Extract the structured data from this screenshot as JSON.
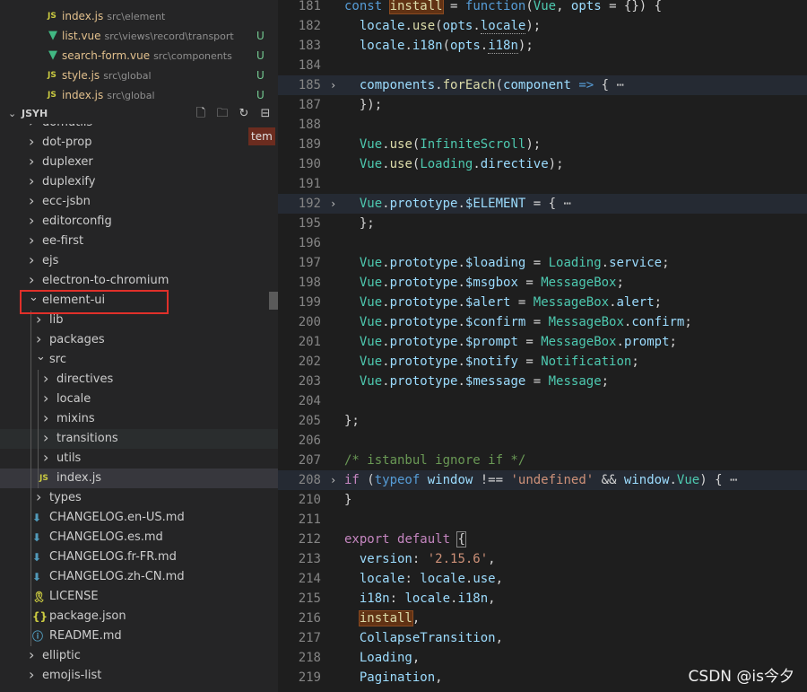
{
  "open_editors": [
    {
      "name": "index.js",
      "path": "src\\element",
      "type": "js",
      "badge": ""
    },
    {
      "name": "list.vue",
      "path": "src\\views\\record\\transport",
      "type": "vue",
      "badge": "U"
    },
    {
      "name": "search-form.vue",
      "path": "src\\components",
      "type": "vue",
      "badge": "U"
    },
    {
      "name": "style.js",
      "path": "src\\global",
      "type": "js",
      "badge": "U"
    },
    {
      "name": "index.js",
      "path": "src\\global",
      "type": "js",
      "badge": "U"
    }
  ],
  "explorer": {
    "title": "JSYH",
    "tooltip": "tem",
    "tree": [
      {
        "label": "domutils",
        "depth": 0,
        "kind": "folder",
        "open": false
      },
      {
        "label": "dot-prop",
        "depth": 0,
        "kind": "folder",
        "open": false
      },
      {
        "label": "duplexer",
        "depth": 0,
        "kind": "folder",
        "open": false
      },
      {
        "label": "duplexify",
        "depth": 0,
        "kind": "folder",
        "open": false
      },
      {
        "label": "ecc-jsbn",
        "depth": 0,
        "kind": "folder",
        "open": false
      },
      {
        "label": "editorconfig",
        "depth": 0,
        "kind": "folder",
        "open": false
      },
      {
        "label": "ee-first",
        "depth": 0,
        "kind": "folder",
        "open": false
      },
      {
        "label": "ejs",
        "depth": 0,
        "kind": "folder",
        "open": false
      },
      {
        "label": "electron-to-chromium",
        "depth": 0,
        "kind": "folder",
        "open": false
      },
      {
        "label": "element-ui",
        "depth": 0,
        "kind": "folder",
        "open": true
      },
      {
        "label": "lib",
        "depth": 1,
        "kind": "folder",
        "open": false
      },
      {
        "label": "packages",
        "depth": 1,
        "kind": "folder",
        "open": false
      },
      {
        "label": "src",
        "depth": 1,
        "kind": "folder",
        "open": true
      },
      {
        "label": "directives",
        "depth": 2,
        "kind": "folder",
        "open": false
      },
      {
        "label": "locale",
        "depth": 2,
        "kind": "folder",
        "open": false
      },
      {
        "label": "mixins",
        "depth": 2,
        "kind": "folder",
        "open": false
      },
      {
        "label": "transitions",
        "depth": 2,
        "kind": "folder",
        "open": false,
        "state": "hover"
      },
      {
        "label": "utils",
        "depth": 2,
        "kind": "folder",
        "open": false
      },
      {
        "label": "index.js",
        "depth": 2,
        "kind": "js",
        "state": "selected"
      },
      {
        "label": "types",
        "depth": 1,
        "kind": "folder",
        "open": false
      },
      {
        "label": "CHANGELOG.en-US.md",
        "depth": 1,
        "kind": "md"
      },
      {
        "label": "CHANGELOG.es.md",
        "depth": 1,
        "kind": "md"
      },
      {
        "label": "CHANGELOG.fr-FR.md",
        "depth": 1,
        "kind": "md"
      },
      {
        "label": "CHANGELOG.zh-CN.md",
        "depth": 1,
        "kind": "md"
      },
      {
        "label": "LICENSE",
        "depth": 1,
        "kind": "license"
      },
      {
        "label": "package.json",
        "depth": 1,
        "kind": "json"
      },
      {
        "label": "README.md",
        "depth": 1,
        "kind": "info"
      },
      {
        "label": "elliptic",
        "depth": 0,
        "kind": "folder",
        "open": false
      },
      {
        "label": "emojis-list",
        "depth": 0,
        "kind": "folder",
        "open": false
      }
    ]
  },
  "icons": {
    "new_file": "new-file-icon",
    "new_folder": "new-folder-icon",
    "refresh": "refresh-icon",
    "collapse": "collapse-all-icon",
    "folder_closed": "chevron-right-icon",
    "folder_open": "chevron-down-icon",
    "js": "js-file-icon",
    "vue": "vue-file-icon",
    "md": "markdown-file-icon",
    "license": "license-file-icon",
    "json": "json-file-icon",
    "info": "info-file-icon"
  },
  "colors": {
    "highlight_box": "#e0302a",
    "untracked": "#73c991",
    "vue_icon": "#41b883",
    "js_icon": "#cbcb41",
    "md_icon": "#519aba"
  },
  "code_lines": [
    {
      "n": "181",
      "fold": false,
      "hl": false,
      "tokens": [
        [
          "kw",
          "const "
        ],
        [
          "mark",
          "install"
        ],
        [
          "pn",
          " = "
        ],
        [
          "kw",
          "function"
        ],
        [
          "pn",
          "("
        ],
        [
          "cls",
          "Vue"
        ],
        [
          "pn",
          ", "
        ],
        [
          "var",
          "opts"
        ],
        [
          "pn",
          " = {}) {"
        ]
      ]
    },
    {
      "n": "182",
      "fold": false,
      "hl": false,
      "tokens": [
        [
          "pn",
          "  "
        ],
        [
          "var",
          "locale"
        ],
        [
          "pn",
          "."
        ],
        [
          "fn",
          "use"
        ],
        [
          "pn",
          "("
        ],
        [
          "var",
          "opts"
        ],
        [
          "pn",
          "."
        ],
        [
          "var-ul",
          "locale"
        ],
        [
          "pn",
          ");"
        ]
      ]
    },
    {
      "n": "183",
      "fold": false,
      "hl": false,
      "tokens": [
        [
          "pn",
          "  "
        ],
        [
          "var",
          "locale"
        ],
        [
          "pn",
          "."
        ],
        [
          "var",
          "i18n"
        ],
        [
          "pn",
          "("
        ],
        [
          "var",
          "opts"
        ],
        [
          "pn",
          "."
        ],
        [
          "var-ul",
          "i18n"
        ],
        [
          "pn",
          ");"
        ]
      ]
    },
    {
      "n": "184",
      "blank": true
    },
    {
      "n": "185",
      "fold": true,
      "hl": true,
      "tokens": [
        [
          "pn",
          "  "
        ],
        [
          "var",
          "components"
        ],
        [
          "pn",
          "."
        ],
        [
          "fn",
          "forEach"
        ],
        [
          "pn",
          "("
        ],
        [
          "var",
          "component"
        ],
        [
          "pn",
          " "
        ],
        [
          "kw",
          "=>"
        ],
        [
          "pn",
          " { "
        ],
        [
          "dim",
          "⋯"
        ]
      ]
    },
    {
      "n": "187",
      "fold": false,
      "hl": false,
      "tokens": [
        [
          "pn",
          "  });"
        ]
      ]
    },
    {
      "n": "188",
      "fold": false,
      "hl": false,
      "tokens": []
    },
    {
      "n": "189",
      "fold": false,
      "hl": false,
      "tokens": [
        [
          "pn",
          "  "
        ],
        [
          "cls",
          "Vue"
        ],
        [
          "pn",
          "."
        ],
        [
          "fn",
          "use"
        ],
        [
          "pn",
          "("
        ],
        [
          "cls",
          "InfiniteScroll"
        ],
        [
          "pn",
          ");"
        ]
      ]
    },
    {
      "n": "190",
      "fold": false,
      "hl": false,
      "tokens": [
        [
          "pn",
          "  "
        ],
        [
          "cls",
          "Vue"
        ],
        [
          "pn",
          "."
        ],
        [
          "fn",
          "use"
        ],
        [
          "pn",
          "("
        ],
        [
          "cls",
          "Loading"
        ],
        [
          "pn",
          "."
        ],
        [
          "var",
          "directive"
        ],
        [
          "pn",
          ");"
        ]
      ]
    },
    {
      "n": "191",
      "fold": false,
      "hl": false,
      "tokens": []
    },
    {
      "n": "192",
      "fold": true,
      "hl": true,
      "tokens": [
        [
          "pn",
          "  "
        ],
        [
          "cls",
          "Vue"
        ],
        [
          "pn",
          "."
        ],
        [
          "var",
          "prototype"
        ],
        [
          "pn",
          "."
        ],
        [
          "var",
          "$ELEMENT"
        ],
        [
          "pn",
          " = { "
        ],
        [
          "dim",
          "⋯"
        ]
      ]
    },
    {
      "n": "195",
      "fold": false,
      "hl": false,
      "tokens": [
        [
          "pn",
          "  };"
        ]
      ]
    },
    {
      "n": "196",
      "fold": false,
      "hl": false,
      "tokens": []
    },
    {
      "n": "197",
      "fold": false,
      "hl": false,
      "tokens": [
        [
          "pn",
          "  "
        ],
        [
          "cls",
          "Vue"
        ],
        [
          "pn",
          "."
        ],
        [
          "var",
          "prototype"
        ],
        [
          "pn",
          "."
        ],
        [
          "var",
          "$loading"
        ],
        [
          "pn",
          " = "
        ],
        [
          "cls",
          "Loading"
        ],
        [
          "pn",
          "."
        ],
        [
          "var",
          "service"
        ],
        [
          "pn",
          ";"
        ]
      ]
    },
    {
      "n": "198",
      "fold": false,
      "hl": false,
      "tokens": [
        [
          "pn",
          "  "
        ],
        [
          "cls",
          "Vue"
        ],
        [
          "pn",
          "."
        ],
        [
          "var",
          "prototype"
        ],
        [
          "pn",
          "."
        ],
        [
          "var",
          "$msgbox"
        ],
        [
          "pn",
          " = "
        ],
        [
          "cls",
          "MessageBox"
        ],
        [
          "pn",
          ";"
        ]
      ]
    },
    {
      "n": "199",
      "fold": false,
      "hl": false,
      "tokens": [
        [
          "pn",
          "  "
        ],
        [
          "cls",
          "Vue"
        ],
        [
          "pn",
          "."
        ],
        [
          "var",
          "prototype"
        ],
        [
          "pn",
          "."
        ],
        [
          "var",
          "$alert"
        ],
        [
          "pn",
          " = "
        ],
        [
          "cls",
          "MessageBox"
        ],
        [
          "pn",
          "."
        ],
        [
          "var",
          "alert"
        ],
        [
          "pn",
          ";"
        ]
      ]
    },
    {
      "n": "200",
      "fold": false,
      "hl": false,
      "tokens": [
        [
          "pn",
          "  "
        ],
        [
          "cls",
          "Vue"
        ],
        [
          "pn",
          "."
        ],
        [
          "var",
          "prototype"
        ],
        [
          "pn",
          "."
        ],
        [
          "var",
          "$confirm"
        ],
        [
          "pn",
          " = "
        ],
        [
          "cls",
          "MessageBox"
        ],
        [
          "pn",
          "."
        ],
        [
          "var",
          "confirm"
        ],
        [
          "pn",
          ";"
        ]
      ]
    },
    {
      "n": "201",
      "fold": false,
      "hl": false,
      "tokens": [
        [
          "pn",
          "  "
        ],
        [
          "cls",
          "Vue"
        ],
        [
          "pn",
          "."
        ],
        [
          "var",
          "prototype"
        ],
        [
          "pn",
          "."
        ],
        [
          "var",
          "$prompt"
        ],
        [
          "pn",
          " = "
        ],
        [
          "cls",
          "MessageBox"
        ],
        [
          "pn",
          "."
        ],
        [
          "var",
          "prompt"
        ],
        [
          "pn",
          ";"
        ]
      ]
    },
    {
      "n": "202",
      "fold": false,
      "hl": false,
      "tokens": [
        [
          "pn",
          "  "
        ],
        [
          "cls",
          "Vue"
        ],
        [
          "pn",
          "."
        ],
        [
          "var",
          "prototype"
        ],
        [
          "pn",
          "."
        ],
        [
          "var",
          "$notify"
        ],
        [
          "pn",
          " = "
        ],
        [
          "cls",
          "Notification"
        ],
        [
          "pn",
          ";"
        ]
      ]
    },
    {
      "n": "203",
      "fold": false,
      "hl": false,
      "tokens": [
        [
          "pn",
          "  "
        ],
        [
          "cls",
          "Vue"
        ],
        [
          "pn",
          "."
        ],
        [
          "var",
          "prototype"
        ],
        [
          "pn",
          "."
        ],
        [
          "var",
          "$message"
        ],
        [
          "pn",
          " = "
        ],
        [
          "cls",
          "Message"
        ],
        [
          "pn",
          ";"
        ]
      ]
    },
    {
      "n": "204",
      "fold": false,
      "hl": false,
      "tokens": []
    },
    {
      "n": "205",
      "fold": false,
      "hl": false,
      "tokens": [
        [
          "pn",
          "};"
        ]
      ]
    },
    {
      "n": "206",
      "fold": false,
      "hl": false,
      "tokens": []
    },
    {
      "n": "207",
      "fold": false,
      "hl": false,
      "tokens": [
        [
          "cm",
          "/* istanbul ignore if */"
        ]
      ]
    },
    {
      "n": "208",
      "fold": true,
      "hl": true,
      "tokens": [
        [
          "ctl",
          "if"
        ],
        [
          "pn",
          " ("
        ],
        [
          "kw",
          "typeof"
        ],
        [
          "pn",
          " "
        ],
        [
          "var",
          "window"
        ],
        [
          "pn",
          " !== "
        ],
        [
          "str",
          "'undefined'"
        ],
        [
          "pn",
          " && "
        ],
        [
          "var",
          "window"
        ],
        [
          "pn",
          "."
        ],
        [
          "cls",
          "Vue"
        ],
        [
          "pn",
          ") { "
        ],
        [
          "dim",
          "⋯"
        ]
      ]
    },
    {
      "n": "210",
      "fold": false,
      "hl": false,
      "tokens": [
        [
          "pn",
          "}"
        ]
      ]
    },
    {
      "n": "211",
      "fold": false,
      "hl": false,
      "tokens": []
    },
    {
      "n": "212",
      "fold": false,
      "hl": false,
      "tokens": [
        [
          "ctl",
          "export"
        ],
        [
          "pn",
          " "
        ],
        [
          "ctl",
          "default"
        ],
        [
          "pn",
          " "
        ],
        [
          "brk",
          "{"
        ]
      ]
    },
    {
      "n": "213",
      "fold": false,
      "hl": false,
      "tokens": [
        [
          "pn",
          "  "
        ],
        [
          "var",
          "version"
        ],
        [
          "pn",
          ": "
        ],
        [
          "str",
          "'2.15.6'"
        ],
        [
          "pn",
          ","
        ]
      ]
    },
    {
      "n": "214",
      "fold": false,
      "hl": false,
      "tokens": [
        [
          "pn",
          "  "
        ],
        [
          "var",
          "locale"
        ],
        [
          "pn",
          ": "
        ],
        [
          "var",
          "locale"
        ],
        [
          "pn",
          "."
        ],
        [
          "var",
          "use"
        ],
        [
          "pn",
          ","
        ]
      ]
    },
    {
      "n": "215",
      "fold": false,
      "hl": false,
      "tokens": [
        [
          "pn",
          "  "
        ],
        [
          "var",
          "i18n"
        ],
        [
          "pn",
          ": "
        ],
        [
          "var",
          "locale"
        ],
        [
          "pn",
          "."
        ],
        [
          "var",
          "i18n"
        ],
        [
          "pn",
          ","
        ]
      ]
    },
    {
      "n": "216",
      "fold": false,
      "hl": false,
      "tokens": [
        [
          "pn",
          "  "
        ],
        [
          "mark",
          "install"
        ],
        [
          "pn",
          ","
        ]
      ]
    },
    {
      "n": "217",
      "fold": false,
      "hl": false,
      "tokens": [
        [
          "pn",
          "  "
        ],
        [
          "var",
          "CollapseTransition"
        ],
        [
          "pn",
          ","
        ]
      ]
    },
    {
      "n": "218",
      "fold": false,
      "hl": false,
      "tokens": [
        [
          "pn",
          "  "
        ],
        [
          "var",
          "Loading"
        ],
        [
          "pn",
          ","
        ]
      ]
    },
    {
      "n": "219",
      "fold": false,
      "hl": false,
      "tokens": [
        [
          "pn",
          "  "
        ],
        [
          "var",
          "Pagination"
        ],
        [
          "pn",
          ","
        ]
      ]
    }
  ],
  "watermark": "CSDN @is今夕"
}
